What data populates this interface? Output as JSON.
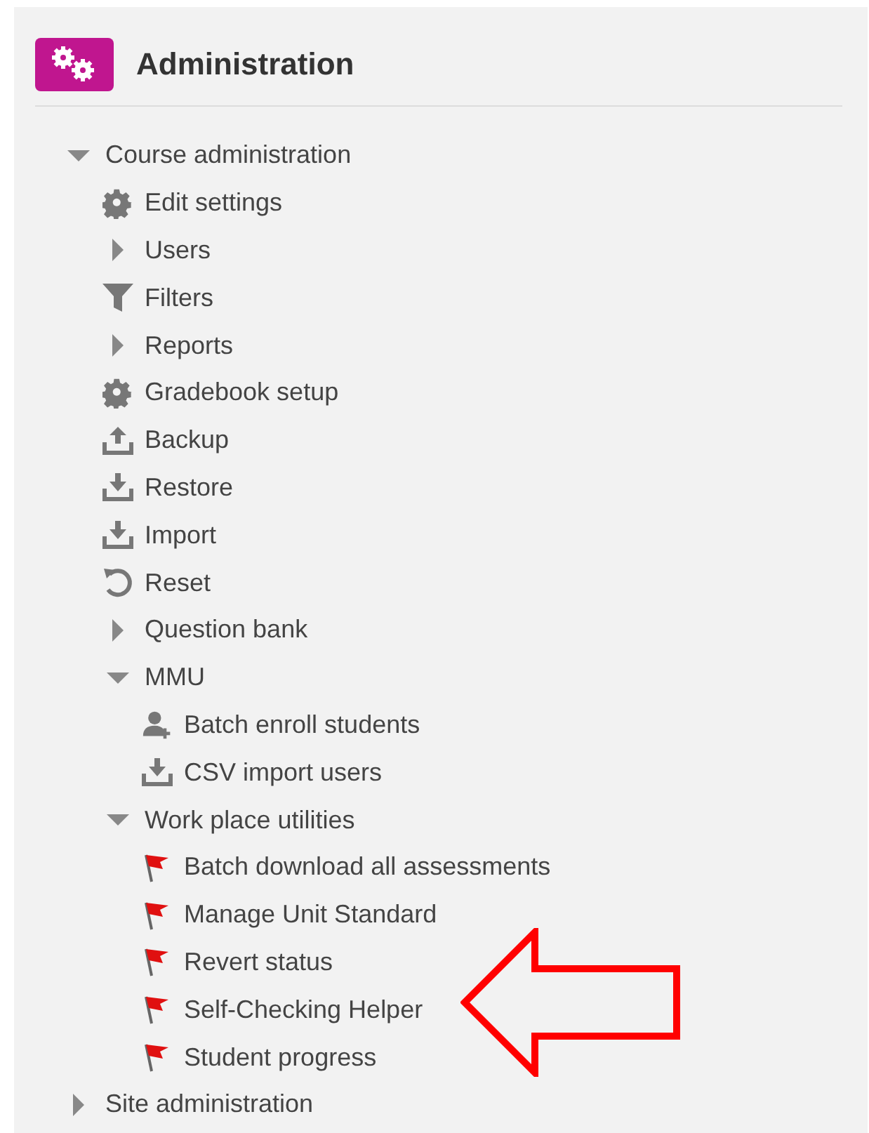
{
  "block": {
    "title": "Administration"
  },
  "tree": [
    {
      "label": "Course administration",
      "kind": "branch",
      "expanded": true,
      "children": [
        {
          "label": "Edit settings",
          "kind": "settings"
        },
        {
          "label": "Users",
          "kind": "branch",
          "expanded": false
        },
        {
          "label": "Filters",
          "kind": "filter"
        },
        {
          "label": "Reports",
          "kind": "branch",
          "expanded": false
        },
        {
          "label": "Gradebook setup",
          "kind": "settings"
        },
        {
          "label": "Backup",
          "kind": "upload"
        },
        {
          "label": "Restore",
          "kind": "download"
        },
        {
          "label": "Import",
          "kind": "download"
        },
        {
          "label": "Reset",
          "kind": "reset"
        },
        {
          "label": "Question bank",
          "kind": "branch",
          "expanded": false
        },
        {
          "label": "MMU",
          "kind": "branch",
          "expanded": true,
          "children": [
            {
              "label": "Batch enroll students",
              "kind": "user-add"
            },
            {
              "label": "CSV import users",
              "kind": "download"
            }
          ]
        },
        {
          "label": "Work place utilities",
          "kind": "branch",
          "expanded": true,
          "children": [
            {
              "label": "Batch download all assessments",
              "kind": "flag"
            },
            {
              "label": "Manage Unit Standard",
              "kind": "flag"
            },
            {
              "label": "Revert status",
              "kind": "flag"
            },
            {
              "label": "Self-Checking Helper",
              "kind": "flag"
            },
            {
              "label": "Student progress",
              "kind": "flag"
            }
          ]
        }
      ]
    },
    {
      "label": "Site administration",
      "kind": "branch",
      "expanded": false
    }
  ]
}
